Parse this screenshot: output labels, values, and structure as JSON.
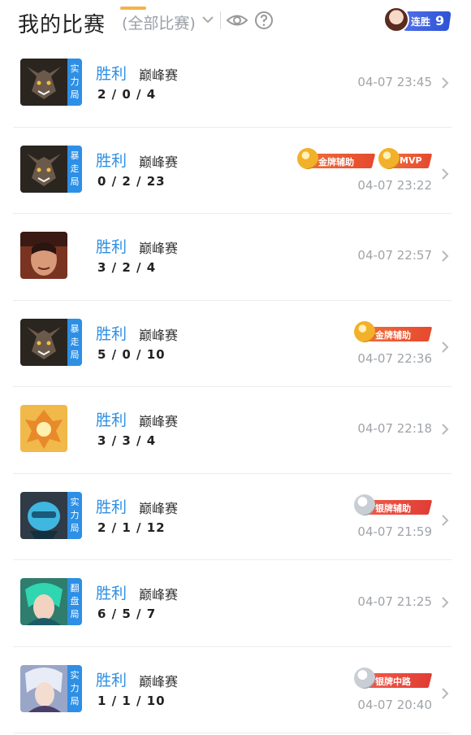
{
  "header": {
    "title": "我的比赛",
    "filter": "(全部比赛)",
    "streak_label": "连胜",
    "streak_count": "9",
    "icons": [
      "chevron-down-icon",
      "eye-icon",
      "help-icon"
    ]
  },
  "matches": [
    {
      "result": "胜利",
      "type": "巅峰赛",
      "kda": "2/0/4",
      "time": "04-07 23:45",
      "mode": "实力局",
      "badges": []
    },
    {
      "result": "胜利",
      "type": "巅峰赛",
      "kda": "0/2/23",
      "time": "04-07 23:22",
      "mode": "暴走局",
      "badges": [
        "金牌辅助",
        "MVP"
      ]
    },
    {
      "result": "胜利",
      "type": "巅峰赛",
      "kda": "3/2/4",
      "time": "04-07 22:57",
      "mode": "",
      "badges": []
    },
    {
      "result": "胜利",
      "type": "巅峰赛",
      "kda": "5/0/10",
      "time": "04-07 22:36",
      "mode": "暴走局",
      "badges": [
        "金牌辅助"
      ]
    },
    {
      "result": "胜利",
      "type": "巅峰赛",
      "kda": "3/3/4",
      "time": "04-07 22:18",
      "mode": "",
      "badges": []
    },
    {
      "result": "胜利",
      "type": "巅峰赛",
      "kda": "2/1/12",
      "time": "04-07 21:59",
      "mode": "实力局",
      "badges": [
        "银牌辅助"
      ]
    },
    {
      "result": "胜利",
      "type": "巅峰赛",
      "kda": "6/5/7",
      "time": "04-07 21:25",
      "mode": "翻盘局",
      "badges": []
    },
    {
      "result": "胜利",
      "type": "巅峰赛",
      "kda": "1/1/10",
      "time": "04-07 20:40",
      "mode": "实力局",
      "badges": [
        "银牌中路"
      ]
    }
  ],
  "colors": {
    "accent": "#2d8fe5",
    "muted": "#a0a4a8",
    "gold_ribbon": "#e54a2e"
  }
}
